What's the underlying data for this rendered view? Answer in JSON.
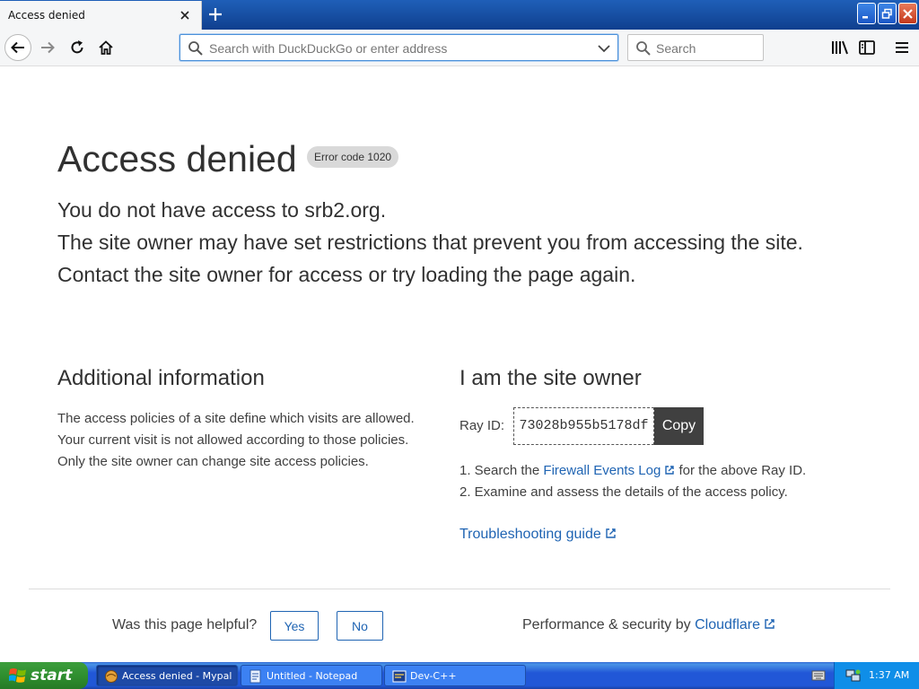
{
  "browser": {
    "tab": {
      "title": "Access denied"
    },
    "address_bar": {
      "placeholder": "Search with DuckDuckGo or enter address"
    },
    "search_box": {
      "placeholder": "Search"
    }
  },
  "page": {
    "title": "Access denied",
    "error_code": "Error code 1020",
    "lead": [
      "You do not have access to srb2.org.",
      "The site owner may have set restrictions that prevent you from accessing the site.",
      "Contact the site owner for access or try loading the page again."
    ],
    "additional": {
      "heading": "Additional information",
      "lines": [
        "The access policies of a site define which visits are allowed.",
        "Your current visit is not allowed according to those policies.",
        "Only the site owner can change site access policies."
      ]
    },
    "owner": {
      "heading": "I am the site owner",
      "ray_label": "Ray ID:",
      "ray_id": "73028b955b5178df",
      "copy_label": "Copy",
      "step1_prefix": "1.  Search the ",
      "step1_link": "Firewall Events Log",
      "step1_suffix": " for the above Ray ID.",
      "step2": "2. Examine and assess the details of the access policy.",
      "troubleshooting": "Troubleshooting guide"
    },
    "footer": {
      "helpful": "Was this page helpful?",
      "yes": "Yes",
      "no": "No",
      "perf_prefix": "Performance & security by ",
      "perf_link": "Cloudflare"
    }
  },
  "taskbar": {
    "start": "start",
    "tasks": [
      "Access denied - Mypal",
      "Untitled - Notepad",
      "Dev-C++"
    ],
    "clock": "1:37 AM"
  },
  "colors": {
    "link": "#1f64b3",
    "text": "#313131",
    "taskbar": "#2157d7",
    "start": "#2f8f2f"
  }
}
